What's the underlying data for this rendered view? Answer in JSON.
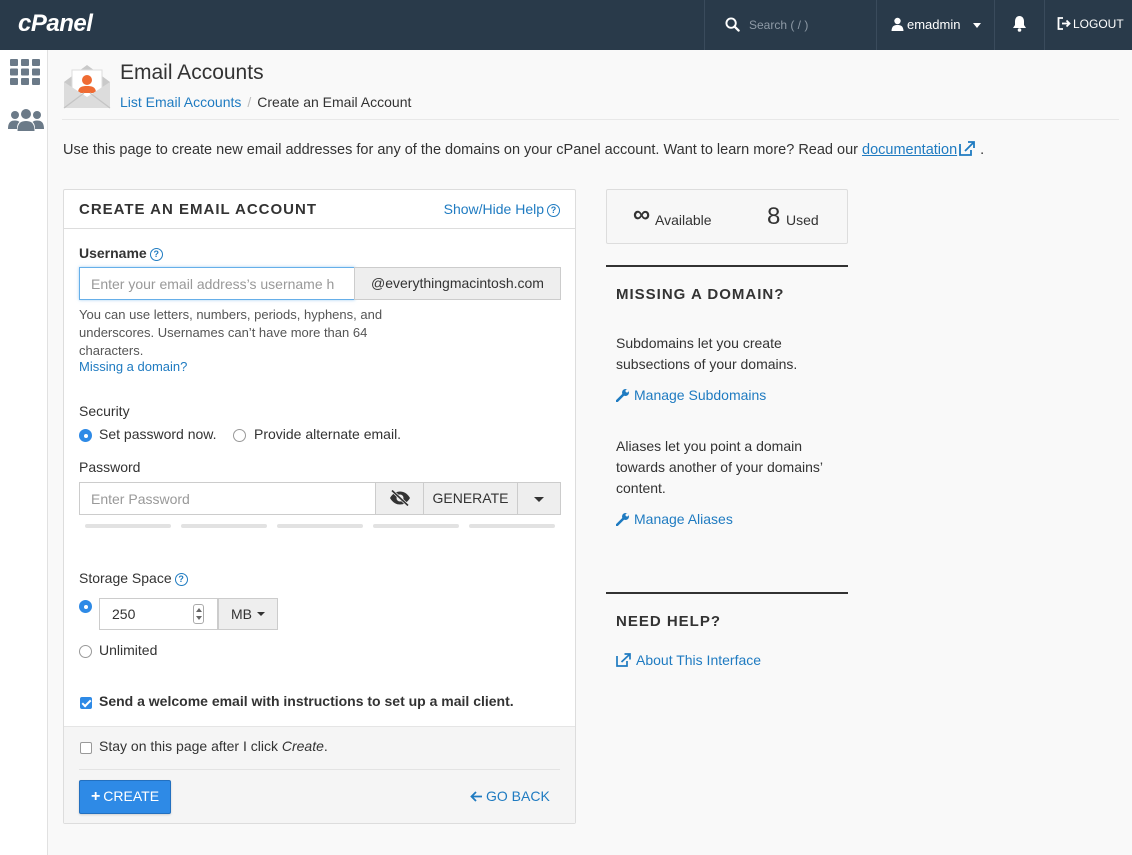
{
  "topbar": {
    "logo": "cPanel",
    "search_placeholder": "Search ( / )",
    "username": "emadmin",
    "logout_label": "LOGOUT"
  },
  "sidebar": {
    "items": [
      {
        "name": "apps-grid-icon"
      },
      {
        "name": "users-icon"
      }
    ]
  },
  "header": {
    "title": "Email Accounts",
    "breadcrumb": {
      "parent": "List Email Accounts",
      "separator": "/",
      "current": "Create an Email Account"
    }
  },
  "intro": {
    "text": "Use this page to create new email addresses for any of the domains on your cPanel account. Want to learn more? Read our ",
    "link": "documentation",
    "suffix": "."
  },
  "form": {
    "title": "CREATE AN EMAIL ACCOUNT",
    "show_hide_help": "Show/Hide Help",
    "username_label": "Username",
    "username_placeholder": "Enter your email address’s username h",
    "domain_suffix": "@everythingmacintosh.com",
    "username_help": "You can use letters, numbers, periods, hyphens, and underscores. Usernames can’t have more than 64 characters.",
    "missing_domain_link": "Missing a domain?",
    "security_label": "Security",
    "security_options": [
      {
        "label": "Set password now.",
        "selected": true
      },
      {
        "label": "Provide alternate email.",
        "selected": false
      }
    ],
    "password_label": "Password",
    "password_placeholder": "Enter Password",
    "generate_label": "GENERATE",
    "storage_label": "Storage Space",
    "storage_value": "250",
    "storage_unit": "MB",
    "storage_selected": "quota",
    "unlimited_label": "Unlimited",
    "welcome_email": {
      "label": "Send a welcome email with instructions to set up a mail client.",
      "checked": true
    },
    "stay_on_page": {
      "prefix": "Stay on this page after I click ",
      "emphasis": "Create",
      "suffix": ".",
      "checked": false
    },
    "create_label": "CREATE",
    "go_back_label": "GO BACK"
  },
  "stats": {
    "available_value": "∞",
    "available_label": "Available",
    "used_value": "8",
    "used_label": "Used"
  },
  "missing_domain": {
    "heading": "MISSING A DOMAIN?",
    "subdomains_text": "Subdomains let you create subsections of your domains.",
    "subdomains_link": "Manage Subdomains",
    "aliases_text": "Aliases let you point a domain towards another of your domains’ content.",
    "aliases_link": "Manage Aliases"
  },
  "need_help": {
    "heading": "NEED HELP?",
    "link": "About This Interface"
  },
  "colors": {
    "topbar": "#293a4a",
    "link": "#1f7bc1",
    "primary": "#2e8ae6",
    "envelope_accent": "#ef6b33"
  }
}
